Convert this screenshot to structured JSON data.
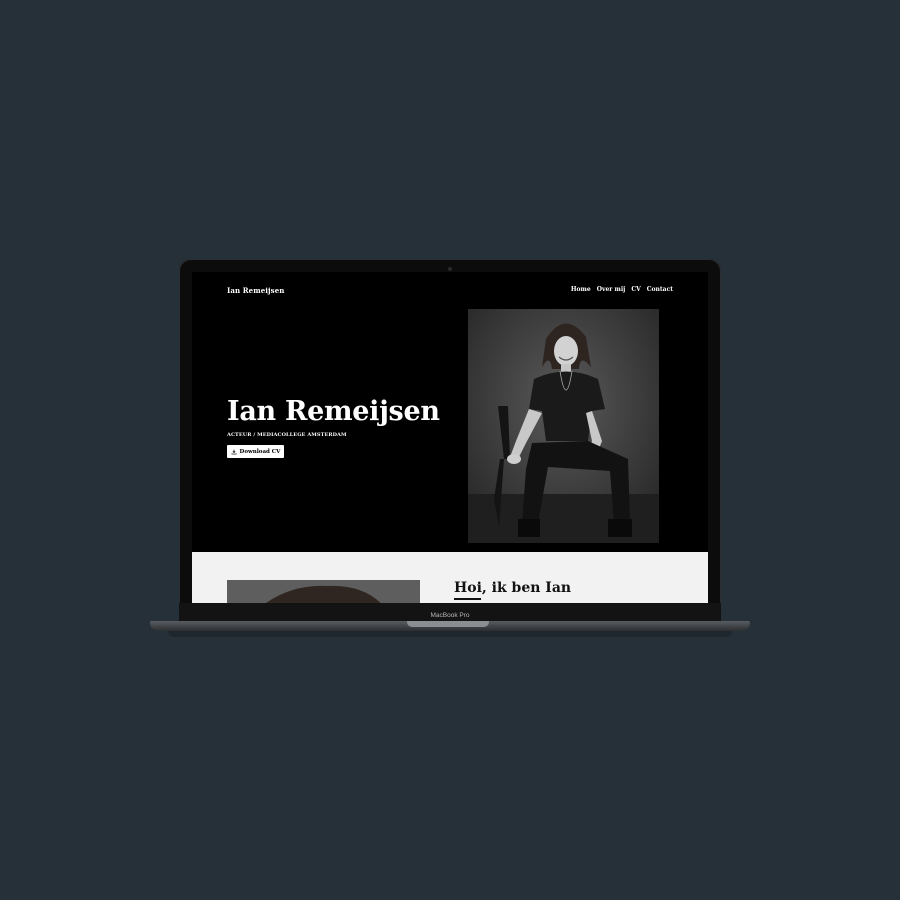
{
  "site": {
    "logo": "Ian Remeijsen",
    "nav": [
      "Home",
      "Over mij",
      "CV",
      "Contact"
    ]
  },
  "hero": {
    "title": "Ian Remeijsen",
    "subtitle": "ACTEUR / MEDIACOLLEGE AMSTERDAM",
    "button_label": "Download CV",
    "button_icon": "download-icon"
  },
  "about": {
    "title": "Hoi, ik ben Ian"
  },
  "device": {
    "model_label": "MacBook Pro"
  },
  "colors": {
    "background": "#263038",
    "screen": "#000000",
    "about_bg": "#f2f2f2"
  }
}
